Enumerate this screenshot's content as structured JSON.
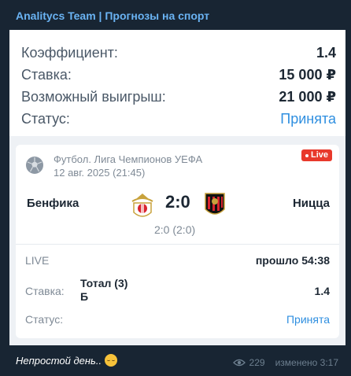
{
  "channel": {
    "title": "Analitycs Team | Прогнозы на спорт"
  },
  "summary": {
    "rows": [
      {
        "label": "Коэффициент:",
        "value": "1.4"
      },
      {
        "label": "Ставка:",
        "value": "15 000 ₽"
      },
      {
        "label": "Возможный выигрыш:",
        "value": "21 000 ₽"
      },
      {
        "label": "Статус:",
        "value": "Принята"
      }
    ]
  },
  "match": {
    "league": "Футбол. Лига Чемпионов УЕФА",
    "datetime": "12 авг. 2025 (21:45)",
    "live_badge": "Live",
    "home_team": "Бенфика",
    "away_team": "Ницца",
    "score": "2:0",
    "half_score": "2:0 (2:0)",
    "live_label": "LIVE",
    "elapsed": "прошло 54:38",
    "bet_label": "Ставка:",
    "bet_name": "Тотал (3) Б",
    "bet_odds": "1.4",
    "status_label": "Статус:",
    "status_value": "Принята"
  },
  "caption": {
    "text": "Непростой день.."
  },
  "meta": {
    "views": "229",
    "edited": "изменено 3:17"
  },
  "icons": {
    "league": "soccer-ball-icon",
    "views": "eye-icon",
    "emoji": "weary-face-icon"
  },
  "colors": {
    "accent": "#2f8fe0",
    "live": "#e8392b",
    "channel": "#6ab3f3"
  }
}
